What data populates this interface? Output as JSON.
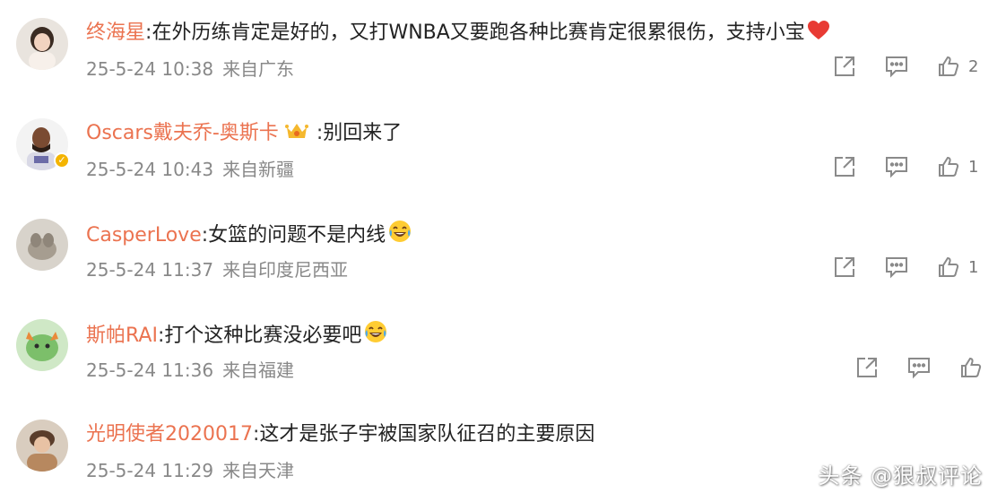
{
  "colors": {
    "username": "#eb7350",
    "text": "#222222",
    "meta": "#888888",
    "icon": "#8a8a8a",
    "badge": "#f4b400"
  },
  "comments": [
    {
      "username": "终海星",
      "separator": ":",
      "text": "在外历练肯定是好的，又打WNBA又要跑各种比赛肯定很累很伤，支持小宝",
      "emoji": "heart-emoji",
      "date": "25-5-24 10:38",
      "location": "来自广东",
      "likes": "2",
      "verified": false
    },
    {
      "username": "Oscars戴夫乔-奥斯卡",
      "separator": ":",
      "text": "别回来了",
      "badge_icon": "crown-badge-icon",
      "date": "25-5-24 10:43",
      "location": "来自新疆",
      "likes": "1",
      "verified": true
    },
    {
      "username": "CasperLove",
      "separator": ":",
      "text": "女篮的问题不是内线",
      "emoji": "laugh-cry-emoji",
      "date": "25-5-24 11:37",
      "location": "来自印度尼西亚",
      "likes": "1",
      "verified": false
    },
    {
      "username": "斯帕RAI",
      "separator": ":",
      "text": "打个这种比赛没必要吧",
      "emoji": "laugh-cry-emoji",
      "date": "25-5-24 11:36",
      "location": "来自福建",
      "likes": "",
      "verified": false
    },
    {
      "username": "光明使者2020017",
      "separator": ":",
      "text": "这才是张子宇被国家队征召的主要原因",
      "date": "25-5-24 11:29",
      "location": "来自天津",
      "likes": "",
      "verified": false
    }
  ],
  "watermark": "头条 @狠叔评论"
}
